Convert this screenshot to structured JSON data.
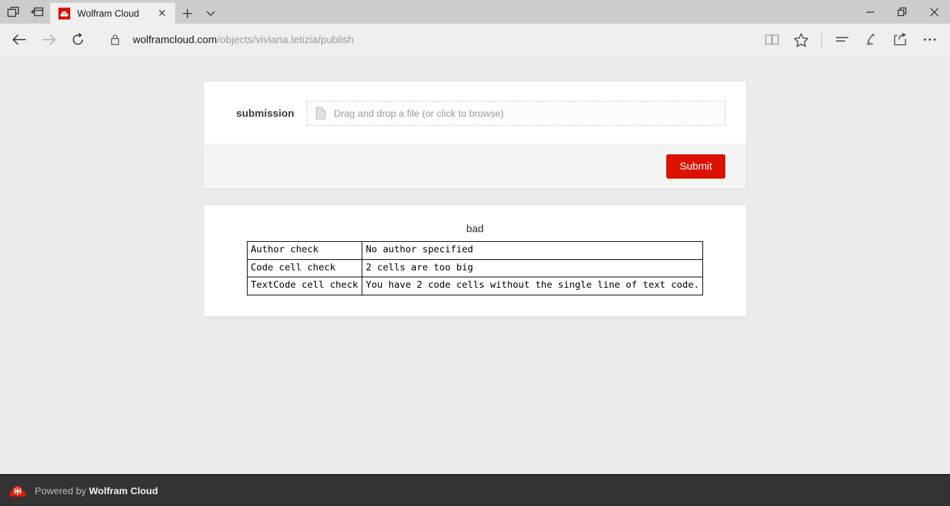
{
  "browser": {
    "tab": {
      "title": "Wolfram Cloud",
      "favicon": "wolfram-cloud-favicon",
      "close": "✕"
    },
    "new_tab_label": "+",
    "tab_menu_label": "⌄",
    "window_controls": {
      "minimize": "—",
      "restore": "❐",
      "close": "✕"
    },
    "nav": {
      "back": "←",
      "forward": "→",
      "refresh": "↻",
      "lock": "lock-icon"
    },
    "address": {
      "host": "wolframcloud.com",
      "path": "/objects/viviana.letizia/publish"
    },
    "toolbar_right": {
      "reading_view": "reading-view-icon",
      "favorites": "star-icon",
      "hub": "hub-icon",
      "web_notes": "web-notes-icon",
      "share": "share-icon",
      "settings": "…"
    }
  },
  "form": {
    "label": "submission",
    "dropzone_placeholder": "Drag and drop a file (or click to browse)",
    "dropzone_icon": "file-icon",
    "submit_label": "Submit"
  },
  "result": {
    "title": "bad",
    "rows": [
      {
        "check": "Author check",
        "message": "No author specified"
      },
      {
        "check": "Code cell check",
        "message": "2 cells are too big"
      },
      {
        "check": "TextCode cell check",
        "message": "You have 2 code cells without the single line of text code."
      }
    ]
  },
  "footer": {
    "prefix": "Powered by ",
    "brand": "Wolfram Cloud",
    "logo": "wolfram-cloud-logo"
  },
  "colors": {
    "accent": "#dd1100",
    "page_background": "#ececec",
    "footer_background": "#333333",
    "chrome_titlebar": "#cccccc",
    "chrome_navbar": "#efefef"
  }
}
